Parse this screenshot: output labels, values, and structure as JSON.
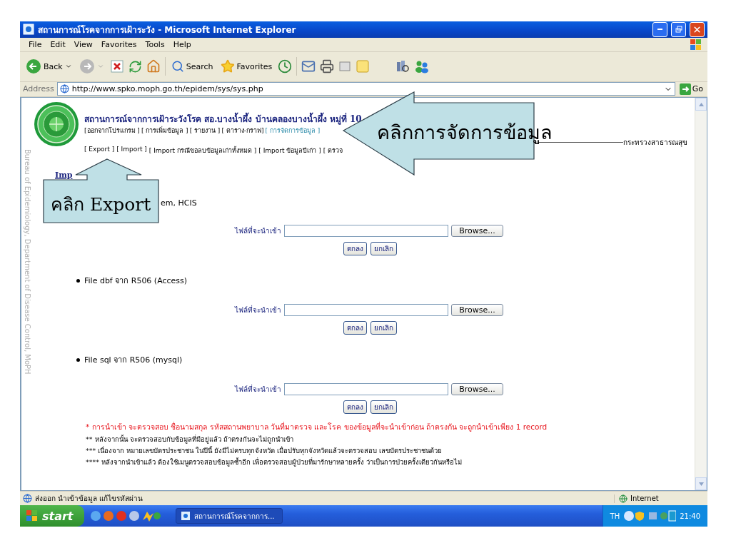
{
  "window": {
    "title": "สถานการณ์โรคจากการเฝ้าระวัง - Microsoft Internet Explorer"
  },
  "menu": [
    "File",
    "Edit",
    "View",
    "Favorites",
    "Tools",
    "Help"
  ],
  "toolbar": {
    "back": "Back",
    "search": "Search",
    "favorites": "Favorites"
  },
  "address": {
    "label": "Address",
    "url": "http://www.spko.moph.go.th/epidem/sys/sys.php",
    "go": "Go"
  },
  "page": {
    "side_text": "Bureau of Epidemiology, Department of Disease Control, MoPH",
    "heading": "สถานการณ์จากการเฝ้าระวังโรค สอ.บางน้ำผึ้ง บ้านคลองบางน้ำผึ้ง หมู่ที่ 10",
    "nav": [
      {
        "label": "[ออกจากโปรแกรม ]",
        "selected": false
      },
      {
        "label": "[ การเพิ่มข้อมูล ]",
        "selected": false
      },
      {
        "label": "[ รายงาน ]",
        "selected": false
      },
      {
        "label": "[ ตาราง-กราฟ]",
        "selected": false
      },
      {
        "label": "[ การจัดการข้อมูล ]",
        "selected": true
      }
    ],
    "ministry": "กระทรวงสาธารณสุข",
    "subnav": [
      "[ Export ]",
      "[ Import ]",
      "[ Import กรณีขอลบข้อมูลเก่าทั้งหมด ]",
      "[ Import ข้อมูลปีเก่า ]",
      "[ ตรวจ"
    ],
    "section_link": "Imp",
    "sections": [
      {
        "title": "em, HCIS",
        "bullet": false,
        "file_label": "ไฟล์ที่จะนำเข้า",
        "browse": "Browse...",
        "ok": "ตกลง",
        "cancel": "ยกเลิก"
      },
      {
        "title": "File dbf จาก R506 (Access)",
        "bullet": true,
        "file_label": "ไฟล์ที่จะนำเข้า",
        "browse": "Browse...",
        "ok": "ตกลง",
        "cancel": "ยกเลิก"
      },
      {
        "title": "File sql จาก R506 (mysql)",
        "bullet": true,
        "file_label": "ไฟล์ที่จะนำเข้า",
        "browse": "Browse...",
        "ok": "ตกลง",
        "cancel": "ยกเลิก"
      }
    ],
    "notes": [
      {
        "kind": "warning",
        "text": "* การนำเข้า จะตรวจสอบ ชื่อนามสกุล รหัสสถานพยาบาล วันที่มาตรวจ และโรค ของข้อมูลที่จะนำเข้าก่อน ถ้าตรงกัน จะถูกนำเข้าเพียง 1 record"
      },
      {
        "kind": "plain",
        "text": "** หลังจากนั้น จะตรวจสอบกับข้อมูลที่มีอยู่แล้ว ถ้าตรงกันจะไม่ถูกนำเข้า"
      },
      {
        "kind": "plain",
        "text": "*** เนื่องจาก หมายเลขบัตรประชาชน ในปีนี้ ยังมีไม่ครบทุกจังหวัด เมื่อปรับทุกจังหวัดแล้วจะตรวจสอบ เลขบัตรประชาชนด้วย"
      },
      {
        "kind": "plain",
        "text": "**** หลังจากนำเข้าแล้ว ต้องใช้เมนูตรวจสอบข้อมูลซ้ำอีก เพื่อตรวจสอบผู้ป่วยที่มารักษาหลายครั้ง ว่าเป็นการป่วยครั้งเดียวกันหรือไม่"
      }
    ]
  },
  "callouts": [
    {
      "kind": "left",
      "text": "คลิกการจัดการข้อมูล"
    },
    {
      "kind": "up",
      "text": "คลิก Export"
    }
  ],
  "status_bar": {
    "text": "ส่งออก นำเข้าข้อมูล แก้ไขรหัสผ่าน",
    "zone": "Internet"
  },
  "taskbar": {
    "start": "start",
    "task": "สถานการณ์โรคจากการ...",
    "language": "TH",
    "clock": "21:40"
  }
}
